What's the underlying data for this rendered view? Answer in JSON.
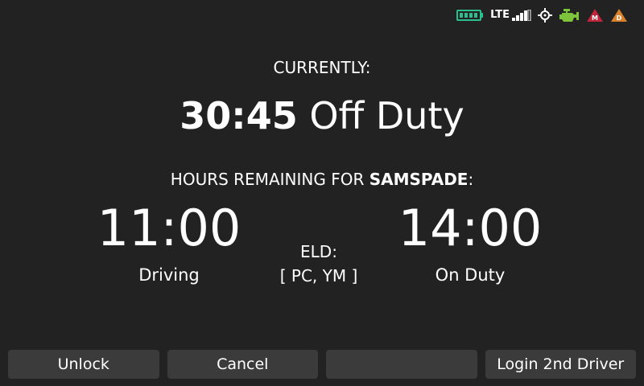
{
  "status_bar": {
    "network_label": "LTE",
    "icons": [
      "battery-icon",
      "signal-bars-icon",
      "gps-icon",
      "engine-icon",
      "malfunction-warning-icon",
      "diagnostic-warning-icon"
    ],
    "malfunction_letter": "M",
    "diagnostic_letter": "D",
    "colors": {
      "battery": "#2bbf8f",
      "engine": "#7ec43a",
      "malfunction": "#c0243a",
      "diagnostic": "#d9822b"
    }
  },
  "current": {
    "label": "CURRENTLY:",
    "time": "30:45",
    "state": "Off Duty"
  },
  "hours": {
    "prefix": "HOURS REMAINING FOR ",
    "driver": "SAMSPADE",
    "suffix": ":",
    "driving_time": "11:00",
    "driving_label": "Driving",
    "onduty_time": "14:00",
    "onduty_label": "On Duty"
  },
  "eld": {
    "label": "ELD:",
    "value": "[ PC, YM ]"
  },
  "buttons": {
    "unlock": "Unlock",
    "cancel": "Cancel",
    "empty": "",
    "login_second": "Login 2nd Driver"
  }
}
